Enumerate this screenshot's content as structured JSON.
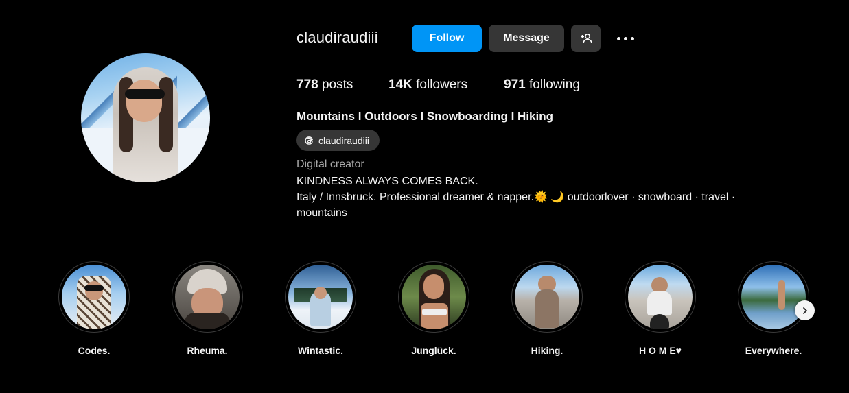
{
  "profile": {
    "username": "claudiraudiii",
    "follow_label": "Follow",
    "message_label": "Message",
    "stats": {
      "posts_count": "778",
      "posts_label": "posts",
      "followers_count": "14K",
      "followers_label": "followers",
      "following_count": "971",
      "following_label": "following"
    },
    "bio_title": "Mountains I Outdoors I Snowboarding I Hiking",
    "threads_handle": "claudiraudiii",
    "category": "Digital creator",
    "bio_lines": [
      "KINDNESS ALWAYS COMES BACK.",
      "Italy / Innsbruck. Professional dreamer & napper.🌞 🌙  outdoorlover · snowboard · travel ·",
      "mountains"
    ]
  },
  "highlights": [
    {
      "label": "Codes."
    },
    {
      "label": "Rheuma."
    },
    {
      "label": "Wintastic."
    },
    {
      "label": "Junglück."
    },
    {
      "label": "Hiking."
    },
    {
      "label": "H O M E♥"
    },
    {
      "label": "Everywhere."
    }
  ],
  "colors": {
    "background": "#000000",
    "follow_button": "#0095f6",
    "secondary_button": "#363636",
    "text": "#f5f5f5",
    "muted_text": "#a8a8a8"
  },
  "icons": {
    "add_user": "add-user-icon",
    "more": "more-options-icon",
    "threads": "threads-icon",
    "next": "chevron-right-icon"
  }
}
